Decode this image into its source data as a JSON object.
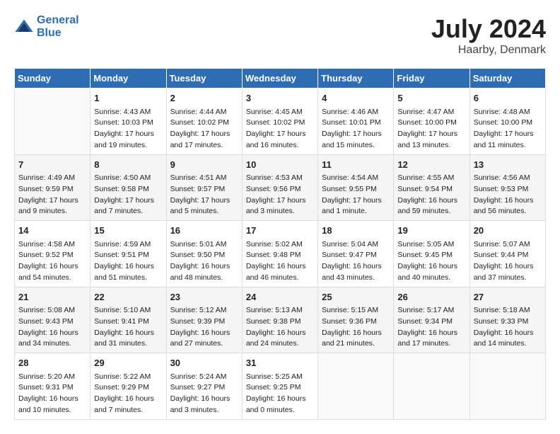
{
  "header": {
    "logo_line1": "General",
    "logo_line2": "Blue",
    "month_year": "July 2024",
    "location": "Haarby, Denmark"
  },
  "days_of_week": [
    "Sunday",
    "Monday",
    "Tuesday",
    "Wednesday",
    "Thursday",
    "Friday",
    "Saturday"
  ],
  "weeks": [
    [
      {
        "day": "",
        "content": ""
      },
      {
        "day": "1",
        "content": "Sunrise: 4:43 AM\nSunset: 10:03 PM\nDaylight: 17 hours\nand 19 minutes."
      },
      {
        "day": "2",
        "content": "Sunrise: 4:44 AM\nSunset: 10:02 PM\nDaylight: 17 hours\nand 17 minutes."
      },
      {
        "day": "3",
        "content": "Sunrise: 4:45 AM\nSunset: 10:02 PM\nDaylight: 17 hours\nand 16 minutes."
      },
      {
        "day": "4",
        "content": "Sunrise: 4:46 AM\nSunset: 10:01 PM\nDaylight: 17 hours\nand 15 minutes."
      },
      {
        "day": "5",
        "content": "Sunrise: 4:47 AM\nSunset: 10:00 PM\nDaylight: 17 hours\nand 13 minutes."
      },
      {
        "day": "6",
        "content": "Sunrise: 4:48 AM\nSunset: 10:00 PM\nDaylight: 17 hours\nand 11 minutes."
      }
    ],
    [
      {
        "day": "7",
        "content": "Sunrise: 4:49 AM\nSunset: 9:59 PM\nDaylight: 17 hours\nand 9 minutes."
      },
      {
        "day": "8",
        "content": "Sunrise: 4:50 AM\nSunset: 9:58 PM\nDaylight: 17 hours\nand 7 minutes."
      },
      {
        "day": "9",
        "content": "Sunrise: 4:51 AM\nSunset: 9:57 PM\nDaylight: 17 hours\nand 5 minutes."
      },
      {
        "day": "10",
        "content": "Sunrise: 4:53 AM\nSunset: 9:56 PM\nDaylight: 17 hours\nand 3 minutes."
      },
      {
        "day": "11",
        "content": "Sunrise: 4:54 AM\nSunset: 9:55 PM\nDaylight: 17 hours\nand 1 minute."
      },
      {
        "day": "12",
        "content": "Sunrise: 4:55 AM\nSunset: 9:54 PM\nDaylight: 16 hours\nand 59 minutes."
      },
      {
        "day": "13",
        "content": "Sunrise: 4:56 AM\nSunset: 9:53 PM\nDaylight: 16 hours\nand 56 minutes."
      }
    ],
    [
      {
        "day": "14",
        "content": "Sunrise: 4:58 AM\nSunset: 9:52 PM\nDaylight: 16 hours\nand 54 minutes."
      },
      {
        "day": "15",
        "content": "Sunrise: 4:59 AM\nSunset: 9:51 PM\nDaylight: 16 hours\nand 51 minutes."
      },
      {
        "day": "16",
        "content": "Sunrise: 5:01 AM\nSunset: 9:50 PM\nDaylight: 16 hours\nand 48 minutes."
      },
      {
        "day": "17",
        "content": "Sunrise: 5:02 AM\nSunset: 9:48 PM\nDaylight: 16 hours\nand 46 minutes."
      },
      {
        "day": "18",
        "content": "Sunrise: 5:04 AM\nSunset: 9:47 PM\nDaylight: 16 hours\nand 43 minutes."
      },
      {
        "day": "19",
        "content": "Sunrise: 5:05 AM\nSunset: 9:45 PM\nDaylight: 16 hours\nand 40 minutes."
      },
      {
        "day": "20",
        "content": "Sunrise: 5:07 AM\nSunset: 9:44 PM\nDaylight: 16 hours\nand 37 minutes."
      }
    ],
    [
      {
        "day": "21",
        "content": "Sunrise: 5:08 AM\nSunset: 9:43 PM\nDaylight: 16 hours\nand 34 minutes."
      },
      {
        "day": "22",
        "content": "Sunrise: 5:10 AM\nSunset: 9:41 PM\nDaylight: 16 hours\nand 31 minutes."
      },
      {
        "day": "23",
        "content": "Sunrise: 5:12 AM\nSunset: 9:39 PM\nDaylight: 16 hours\nand 27 minutes."
      },
      {
        "day": "24",
        "content": "Sunrise: 5:13 AM\nSunset: 9:38 PM\nDaylight: 16 hours\nand 24 minutes."
      },
      {
        "day": "25",
        "content": "Sunrise: 5:15 AM\nSunset: 9:36 PM\nDaylight: 16 hours\nand 21 minutes."
      },
      {
        "day": "26",
        "content": "Sunrise: 5:17 AM\nSunset: 9:34 PM\nDaylight: 16 hours\nand 17 minutes."
      },
      {
        "day": "27",
        "content": "Sunrise: 5:18 AM\nSunset: 9:33 PM\nDaylight: 16 hours\nand 14 minutes."
      }
    ],
    [
      {
        "day": "28",
        "content": "Sunrise: 5:20 AM\nSunset: 9:31 PM\nDaylight: 16 hours\nand 10 minutes."
      },
      {
        "day": "29",
        "content": "Sunrise: 5:22 AM\nSunset: 9:29 PM\nDaylight: 16 hours\nand 7 minutes."
      },
      {
        "day": "30",
        "content": "Sunrise: 5:24 AM\nSunset: 9:27 PM\nDaylight: 16 hours\nand 3 minutes."
      },
      {
        "day": "31",
        "content": "Sunrise: 5:25 AM\nSunset: 9:25 PM\nDaylight: 16 hours\nand 0 minutes."
      },
      {
        "day": "",
        "content": ""
      },
      {
        "day": "",
        "content": ""
      },
      {
        "day": "",
        "content": ""
      }
    ]
  ]
}
